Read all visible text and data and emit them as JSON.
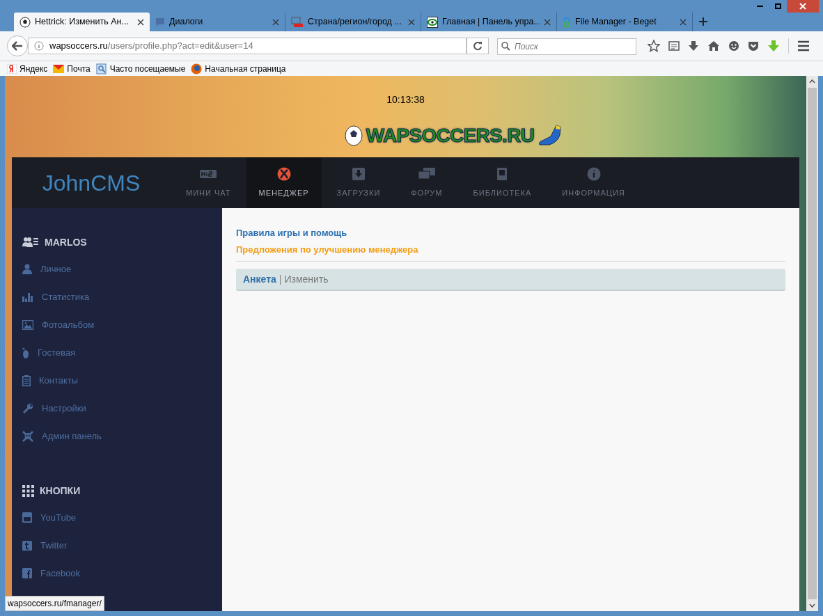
{
  "browser": {
    "tabs": [
      {
        "title": "Hettrick: Изменить Ан...",
        "selected": true
      },
      {
        "title": "Диалоги",
        "selected": false
      },
      {
        "title": "Страна/регион/город ...",
        "selected": false
      },
      {
        "title": "Главная | Панель упра...",
        "selected": false
      },
      {
        "title": "File Manager - Beget",
        "selected": false
      }
    ],
    "url": {
      "host": "wapsoccers.ru",
      "path": "/users/profile.php?act=edit&user=14"
    },
    "search": {
      "placeholder": "Поиск"
    },
    "bookmarks": [
      {
        "label": "Яндекс"
      },
      {
        "label": "Почта"
      },
      {
        "label": "Часто посещаемые"
      },
      {
        "label": "Начальная страница"
      }
    ],
    "status_bar": "wapsoccers.ru/fmanager/"
  },
  "page": {
    "clock": "10:13:38",
    "logo": "WAPSOCCERS.RU",
    "brand": "JohnCMS",
    "nav": [
      {
        "label": "МИНИ ЧАТ",
        "selected": false
      },
      {
        "label": "МЕНЕДЖЕР",
        "selected": true
      },
      {
        "label": "ЗАГРУЗКИ",
        "selected": false
      },
      {
        "label": "ФОРУМ",
        "selected": false
      },
      {
        "label": "БИБЛИОТЕКА",
        "selected": false
      },
      {
        "label": "ИНФОРМАЦИЯ",
        "selected": false
      }
    ],
    "sidebar": [
      {
        "title": "MARLOS",
        "items": [
          {
            "label": "Личное"
          },
          {
            "label": "Статистика"
          },
          {
            "label": "Фотоальбом"
          },
          {
            "label": "Гостевая"
          },
          {
            "label": "Контакты"
          },
          {
            "label": "Настройки"
          },
          {
            "label": "Админ панель"
          }
        ]
      },
      {
        "title": "КНОПКИ",
        "items": [
          {
            "label": "YouTube"
          },
          {
            "label": "Twitter"
          },
          {
            "label": "Facebook"
          }
        ]
      }
    ],
    "links": [
      {
        "text": "Правила игры и помощь",
        "kind": "primary"
      },
      {
        "text": "Предложения по улучшению менеджера",
        "kind": "accent"
      }
    ],
    "breadcrumb": {
      "current": "Анкета",
      "separator": "|",
      "rest": "Изменить"
    }
  }
}
